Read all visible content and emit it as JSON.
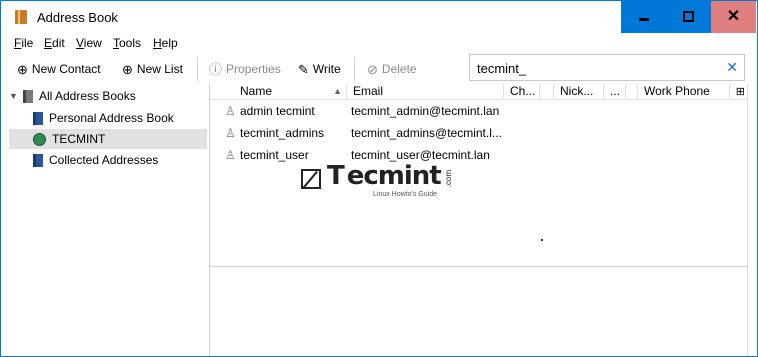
{
  "window": {
    "title": "Address Book"
  },
  "menu": [
    {
      "label": "File",
      "accel": "F",
      "rest": "ile"
    },
    {
      "label": "Edit",
      "accel": "E",
      "rest": "dit"
    },
    {
      "label": "View",
      "accel": "V",
      "rest": "iew"
    },
    {
      "label": "Tools",
      "accel": "T",
      "rest": "ools"
    },
    {
      "label": "Help",
      "accel": "H",
      "rest": "elp"
    }
  ],
  "toolbar": {
    "new_contact": "New Contact",
    "new_list": "New List",
    "properties": "Properties",
    "write": "Write",
    "delete": "Delete"
  },
  "search": {
    "value": "tecmint_"
  },
  "tree": {
    "all": "All Address Books",
    "personal": "Personal Address Book",
    "tecmint": "TECMINT",
    "collected": "Collected Addresses"
  },
  "columns": {
    "name": "Name",
    "email": "Email",
    "chat": "Ch...",
    "nick": "Nick...",
    "more": "...",
    "work_phone": "Work Phone"
  },
  "contacts": [
    {
      "name": "admin tecmint",
      "email": "tecmint_admin@tecmint.lan"
    },
    {
      "name": "tecmint_admins",
      "email": "tecmint_admins@tecmint.l..."
    },
    {
      "name": "tecmint_user",
      "email": "tecmint_user@tecmint.lan"
    }
  ],
  "watermark": {
    "brand_t": "T",
    "brand_rest": "ecmint",
    "com": ".com",
    "tagline": "Linux Howto's Guide"
  },
  "colors": {
    "accent": "#0078d7",
    "close_hover": "#e07f7f",
    "selection": "#e1e1e1"
  }
}
